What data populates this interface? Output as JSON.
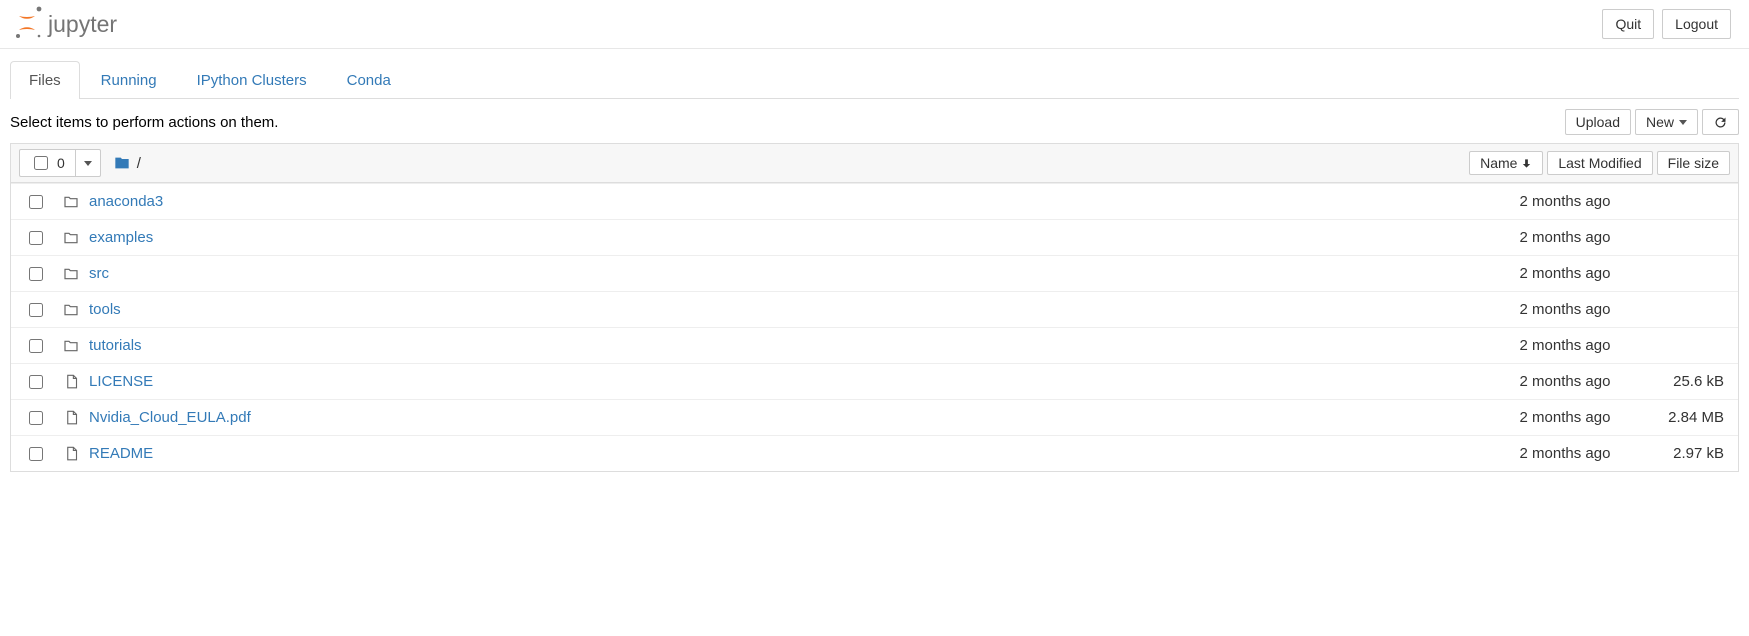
{
  "header": {
    "logo_text": "jupyter",
    "quit": "Quit",
    "logout": "Logout"
  },
  "tabs": [
    {
      "label": "Files",
      "active": true
    },
    {
      "label": "Running",
      "active": false
    },
    {
      "label": "IPython Clusters",
      "active": false
    },
    {
      "label": "Conda",
      "active": false
    }
  ],
  "hint": "Select items to perform actions on them.",
  "actions": {
    "upload": "Upload",
    "new": "New"
  },
  "select_count": "0",
  "breadcrumb_root": "/",
  "columns": {
    "name": "Name",
    "modified": "Last Modified",
    "size": "File size"
  },
  "items": [
    {
      "type": "folder",
      "name": "anaconda3",
      "modified": "2 months ago",
      "size": ""
    },
    {
      "type": "folder",
      "name": "examples",
      "modified": "2 months ago",
      "size": ""
    },
    {
      "type": "folder",
      "name": "src",
      "modified": "2 months ago",
      "size": ""
    },
    {
      "type": "folder",
      "name": "tools",
      "modified": "2 months ago",
      "size": ""
    },
    {
      "type": "folder",
      "name": "tutorials",
      "modified": "2 months ago",
      "size": ""
    },
    {
      "type": "file",
      "name": "LICENSE",
      "modified": "2 months ago",
      "size": "25.6 kB"
    },
    {
      "type": "file",
      "name": "Nvidia_Cloud_EULA.pdf",
      "modified": "2 months ago",
      "size": "2.84 MB"
    },
    {
      "type": "file",
      "name": "README",
      "modified": "2 months ago",
      "size": "2.97 kB"
    }
  ]
}
